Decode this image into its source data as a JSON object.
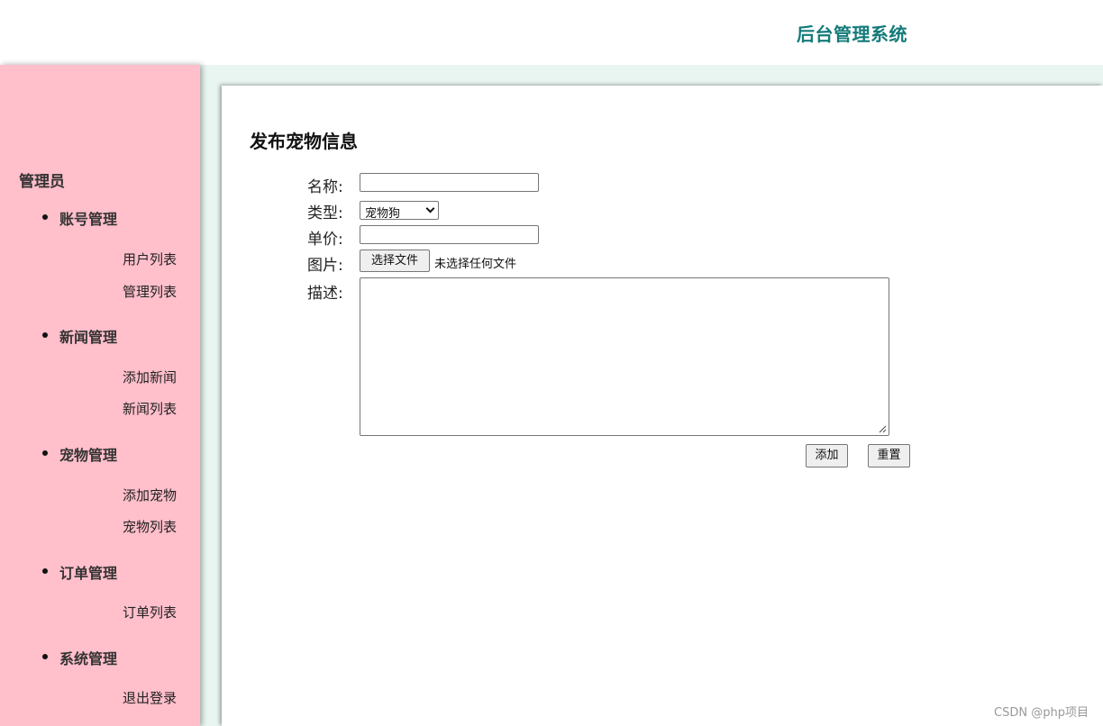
{
  "header": {
    "title": "后台管理系统"
  },
  "sidebar": {
    "heading": "管理员",
    "groups": [
      {
        "title": "账号管理",
        "items": [
          "用户列表",
          "管理列表"
        ]
      },
      {
        "title": "新闻管理",
        "items": [
          "添加新闻",
          "新闻列表"
        ]
      },
      {
        "title": "宠物管理",
        "items": [
          "添加宠物",
          "宠物列表"
        ]
      },
      {
        "title": "订单管理",
        "items": [
          "订单列表"
        ]
      },
      {
        "title": "系统管理",
        "items": [
          "退出登录"
        ]
      }
    ]
  },
  "form": {
    "title": "发布宠物信息",
    "labels": {
      "name": "名称:",
      "type": "类型:",
      "price": "单价:",
      "image": "图片:",
      "description": "描述:"
    },
    "name_value": "",
    "type_selected": "宠物狗",
    "price_value": "",
    "file_button_label": "选择文件",
    "file_status": "未选择任何文件",
    "description_value": "",
    "submit_label": "添加",
    "reset_label": "重置"
  },
  "watermark": "CSDN @php项目",
  "colors": {
    "sidebar_bg": "#ffbfcb",
    "header_title": "#147a7a",
    "content_bg": "#e9f5f1"
  }
}
